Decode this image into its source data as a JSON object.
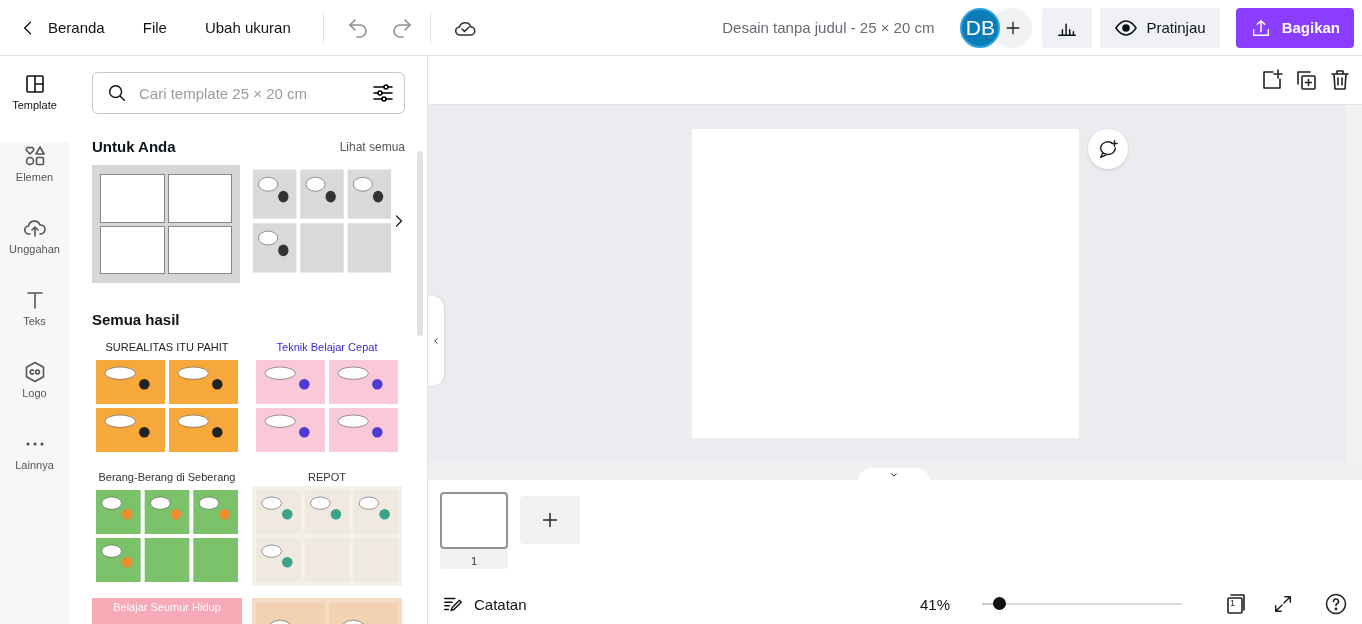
{
  "topbar": {
    "back": "Beranda",
    "menus": [
      "File",
      "Ubah ukuran"
    ],
    "doc_title": "Desain tanpa judul - 25 × 20 cm",
    "avatar": "DB",
    "preview": "Pratinjau",
    "share": "Bagikan"
  },
  "rail": [
    {
      "label": "Template",
      "selected": true
    },
    {
      "label": "Elemen",
      "selected": false
    },
    {
      "label": "Unggahan",
      "selected": false
    },
    {
      "label": "Teks",
      "selected": false
    },
    {
      "label": "Logo",
      "selected": false
    },
    {
      "label": "Lainnya",
      "selected": false
    }
  ],
  "panel": {
    "search": {
      "placeholder": "Cari template 25 × 20 cm"
    },
    "for_you": {
      "title": "Untuk Anda",
      "see_all": "Lihat semua",
      "items": [
        {
          "kind": "layout"
        },
        {
          "kind": "picture"
        }
      ]
    },
    "all_results": {
      "title": "Semua hasil",
      "items": [
        {
          "title": "SUREALITAS ITU PAHIT"
        },
        {
          "title": "Teknik Belajar Cepat"
        },
        {
          "title": "Berang-Berang di Seberang"
        },
        {
          "title": "REPOT"
        },
        {
          "title": "Belajar Seumur Hidup"
        },
        {
          "kind": "picture"
        }
      ]
    }
  },
  "pages": [
    {
      "number": "1",
      "selected": true
    }
  ],
  "footer": {
    "notes": "Catatan",
    "zoom": "41%",
    "level": 0.06,
    "page_count": "1"
  }
}
